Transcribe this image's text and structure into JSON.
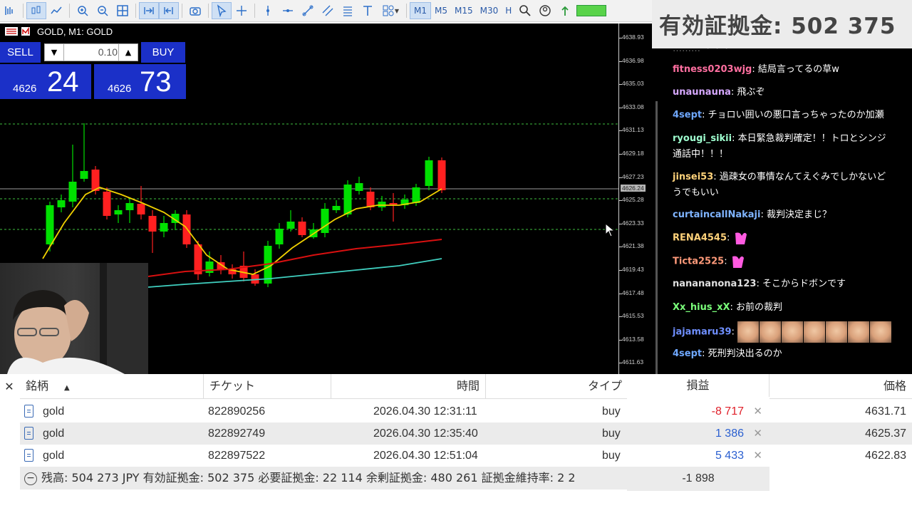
{
  "toolbar": {
    "timeframes": [
      "M1",
      "M5",
      "M15",
      "M30",
      "H"
    ],
    "active_timeframe": "M1"
  },
  "chart": {
    "title": "GOLD, M1:  GOLD",
    "price_ticks": [
      "4638.93",
      "4636.98",
      "4635.03",
      "4633.08",
      "4631.13",
      "4629.18",
      "4627.23",
      "4625.28",
      "4623.33",
      "4621.38",
      "4619.43",
      "4617.48",
      "4615.53",
      "4613.58",
      "4611.63"
    ],
    "current_price_tag": "4626.24",
    "colors": {
      "bull": "#00e000",
      "bear": "#ff2020",
      "ma_fast": "#f0d000",
      "ma_mid": "#d81010",
      "ma_slow": "#40d0c0",
      "level_line": "#40c040"
    }
  },
  "oneclick": {
    "sell_label": "SELL",
    "buy_label": "BUY",
    "volume": "0.10",
    "sell_small": "4626",
    "sell_big": "24",
    "buy_small": "4626",
    "buy_big": "73"
  },
  "overlay": {
    "margin_label": "有効証拠金: 502 375"
  },
  "chat": {
    "messages": [
      {
        "user": "fitness0203wjg",
        "color": "#ff6fa0",
        "text": "結局言ってるの草w"
      },
      {
        "user": "unaunauna",
        "color": "#d6a8ff",
        "text": "飛ぶぞ"
      },
      {
        "user": "4sept",
        "color": "#6fa8ff",
        "text": "チョロい囲いの悪口言っちゃったのか加瀬"
      },
      {
        "user": "ryougi_sikii",
        "color": "#9fffd0",
        "text": "本日緊急裁判確定！！トロとシンジ通話中！！！"
      },
      {
        "user": "jinsei53",
        "color": "#ffd27a",
        "text": "過疎女の事情なんてえぐみでしかないどうでもいい"
      },
      {
        "user": "curtaincallNakaji",
        "color": "#7fb4ff",
        "text": "裁判決定まじ？"
      },
      {
        "user": "RENA4545",
        "color": "#ffd27a",
        "text": ""
      },
      {
        "user": "Ticta2525",
        "color": "#ff9a7a",
        "text": ""
      },
      {
        "user": "nanananona123",
        "color": "#e0e0e0",
        "text": "そこからドボンです"
      },
      {
        "user": "Xx_hius_xX",
        "color": "#7aff7a",
        "text": "お前の裁判"
      },
      {
        "user": "jajamaru39",
        "color": "#6f8fff",
        "text": ""
      },
      {
        "user": "4sept",
        "color": "#6fa8ff",
        "text": "死刑判決出るのか"
      }
    ]
  },
  "terminal": {
    "headers": [
      "銘柄",
      "チケット",
      "時間",
      "タイプ",
      "損益",
      "価格"
    ],
    "rows": [
      {
        "symbol": "gold",
        "ticket": "822890256",
        "time": "2026.04.30 12:31:11",
        "type": "buy",
        "profit": "-8 717",
        "price": "4631.71"
      },
      {
        "symbol": "gold",
        "ticket": "822892749",
        "time": "2026.04.30 12:35:40",
        "type": "buy",
        "profit": "1 386",
        "price": "4625.37"
      },
      {
        "symbol": "gold",
        "ticket": "822897522",
        "time": "2026.04.30 12:51:04",
        "type": "buy",
        "profit": "5 433",
        "price": "4622.83"
      }
    ],
    "balance_line": "残高: 504 273 JPY  有効証拠金: 502 375  必要証拠金: 22 114  余剰証拠金: 480 261  証拠金維持率: 2 2",
    "total_profit": "-1 898",
    "colors": {
      "loss": "#e0202a",
      "gain": "#2a5fd0"
    }
  }
}
